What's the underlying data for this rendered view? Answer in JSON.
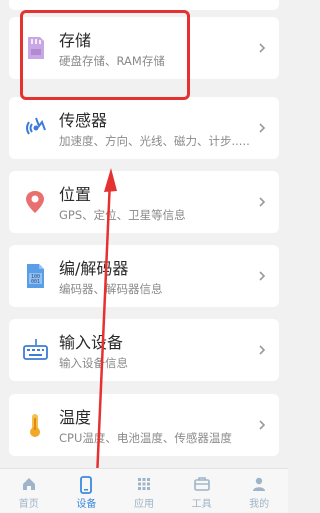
{
  "items": [
    {
      "title": "存储",
      "subtitle": "硬盘存储、RAM存储",
      "icon": "sd-card-icon"
    },
    {
      "title": "传感器",
      "subtitle": "加速度、方向、光线、磁力、计步.....",
      "icon": "sensor-waves-icon"
    },
    {
      "title": "位置",
      "subtitle": "GPS、定位、卫星等信息",
      "icon": "location-pin-icon"
    },
    {
      "title": "编/解码器",
      "subtitle": "编码器、解码器信息",
      "icon": "binary-file-icon"
    },
    {
      "title": "输入设备",
      "subtitle": "输入设备信息",
      "icon": "keyboard-icon"
    },
    {
      "title": "温度",
      "subtitle": "CPU温度、电池温度、传感器温度",
      "icon": "thermometer-icon"
    }
  ],
  "tabs": [
    {
      "label": "首页",
      "icon": "home-icon",
      "active": false
    },
    {
      "label": "设备",
      "icon": "phone-icon",
      "active": true
    },
    {
      "label": "应用",
      "icon": "grid-icon",
      "active": false
    },
    {
      "label": "工具",
      "icon": "toolbox-icon",
      "active": false
    },
    {
      "label": "我的",
      "icon": "person-icon",
      "active": false
    }
  ],
  "colors": {
    "highlight": "#e63131",
    "arrow": "#e63131",
    "active_tab": "#3d8ae0",
    "inactive_tab": "#9fb4c8"
  }
}
